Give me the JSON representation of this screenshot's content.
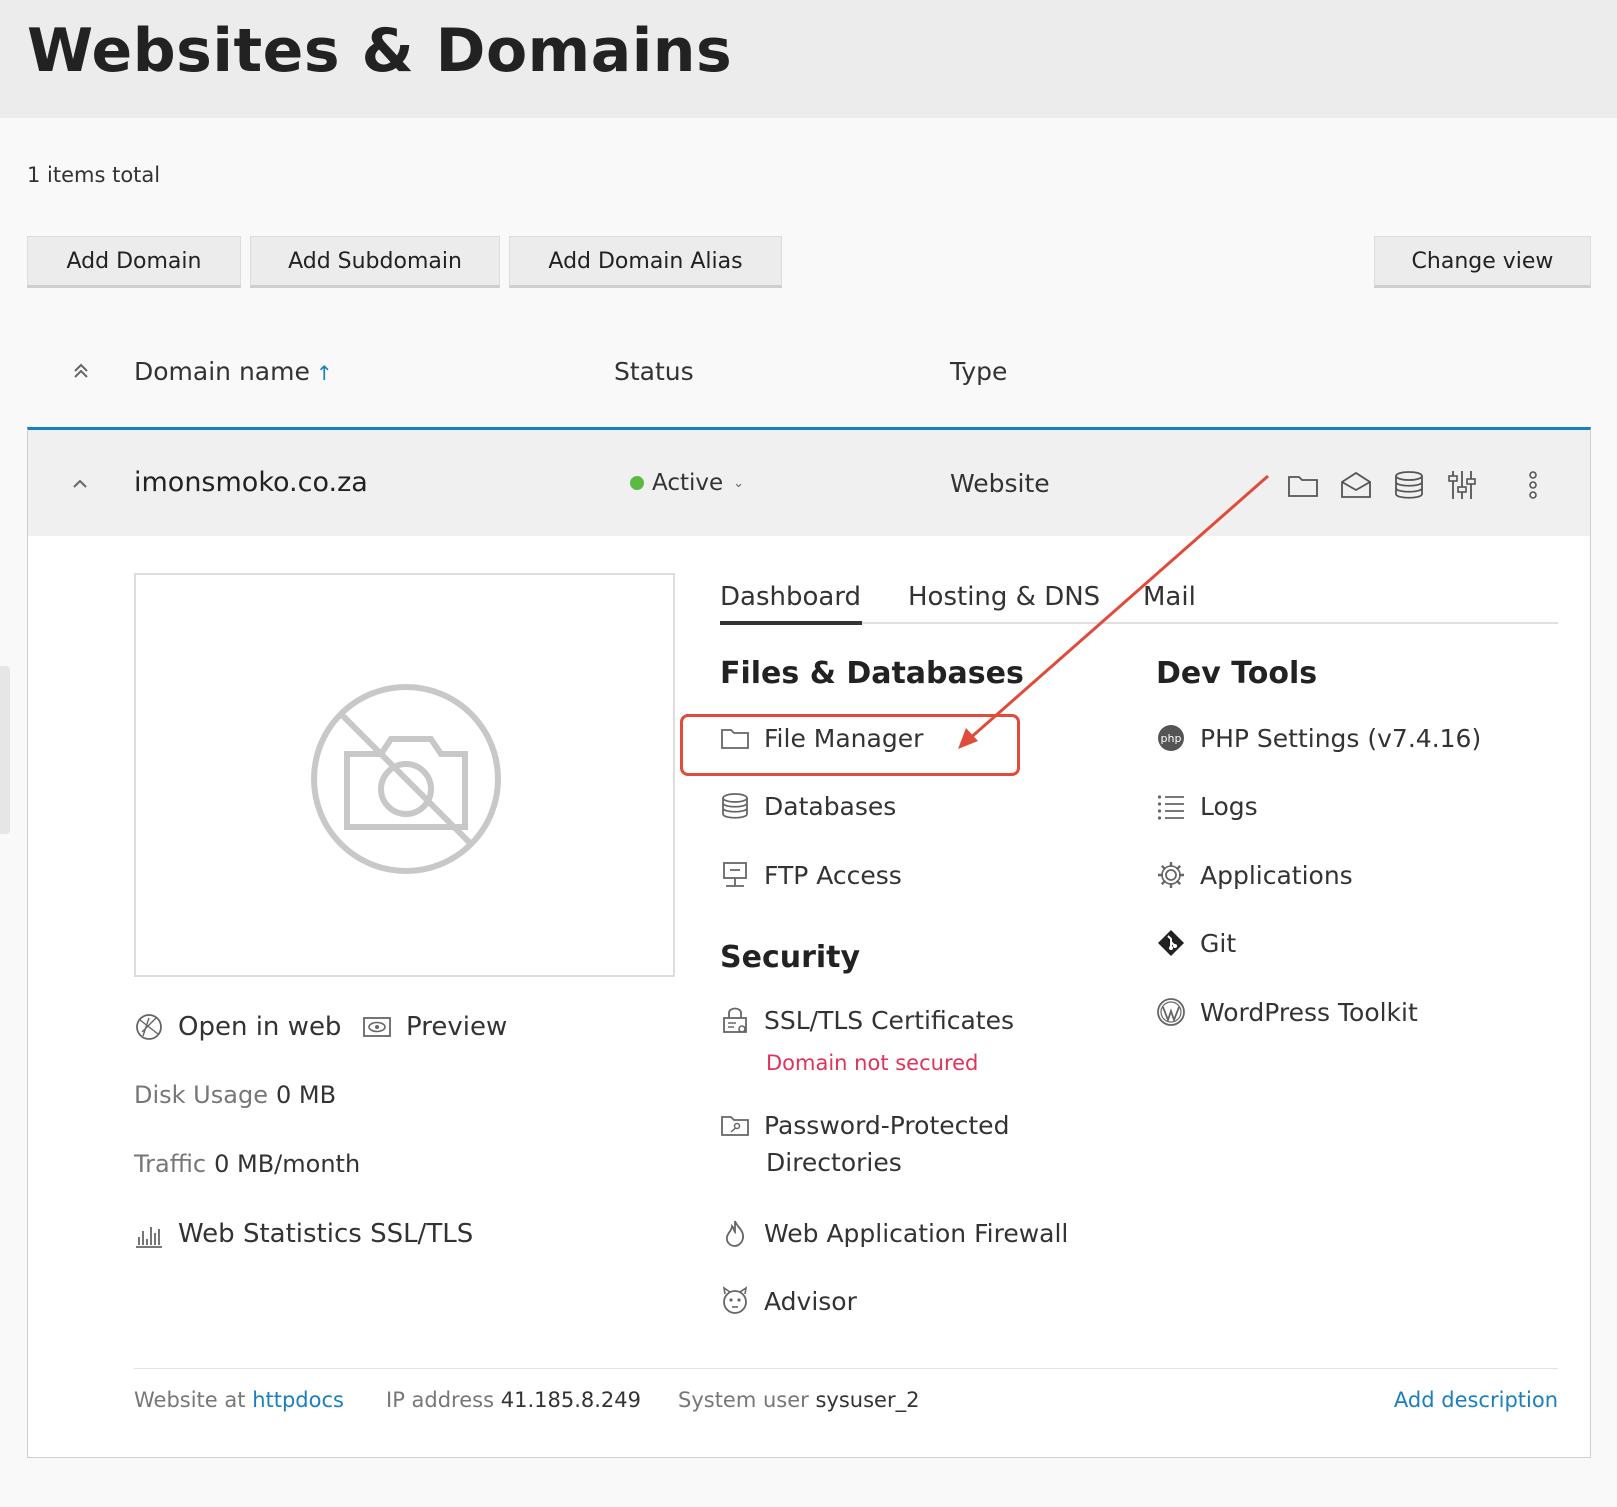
{
  "header": {
    "title": "Websites & Domains"
  },
  "list": {
    "items_total": "1 items total"
  },
  "toolbar": {
    "add_domain": "Add Domain",
    "add_subdomain": "Add Subdomain",
    "add_domain_alias": "Add Domain Alias",
    "change_view": "Change view"
  },
  "columns": {
    "domain_name": "Domain name",
    "sort_arrow": "↑",
    "status": "Status",
    "type": "Type"
  },
  "domain": {
    "name": "imonsmoko.co.za",
    "status": "Active",
    "type": "Website",
    "status_color": "#5bb944"
  },
  "preview": {
    "open_in_web": "Open in web",
    "preview": "Preview",
    "disk_usage_label": "Disk Usage",
    "disk_usage_value": "0 MB",
    "traffic_label": "Traffic",
    "traffic_value": "0 MB/month",
    "web_stats": "Web Statistics SSL/TLS"
  },
  "tabs": [
    "Dashboard",
    "Hosting & DNS",
    "Mail"
  ],
  "files_databases": {
    "title": "Files & Databases",
    "file_manager": "File Manager",
    "databases": "Databases",
    "ftp_access": "FTP Access"
  },
  "security": {
    "title": "Security",
    "ssl": "SSL/TLS Certificates",
    "ssl_warning": "Domain not secured",
    "ppd_line1": "Password-Protected",
    "ppd_line2": "Directories",
    "waf": "Web Application Firewall",
    "advisor": "Advisor"
  },
  "dev_tools": {
    "title": "Dev Tools",
    "php": "PHP Settings (v7.4.16)",
    "logs": "Logs",
    "applications": "Applications",
    "git": "Git",
    "wordpress": "WordPress Toolkit",
    "php_icon_text": "php"
  },
  "footer": {
    "website_at_label": "Website at",
    "website_at_value": "httpdocs",
    "ip_label": "IP address",
    "ip_value": "41.185.8.249",
    "sysuser_label": "System user",
    "sysuser_value": "sysuser_2",
    "add_description": "Add description"
  },
  "colors": {
    "accent": "#1a7fbf",
    "warning": "#e0325a",
    "annotation": "#e04b3a"
  }
}
